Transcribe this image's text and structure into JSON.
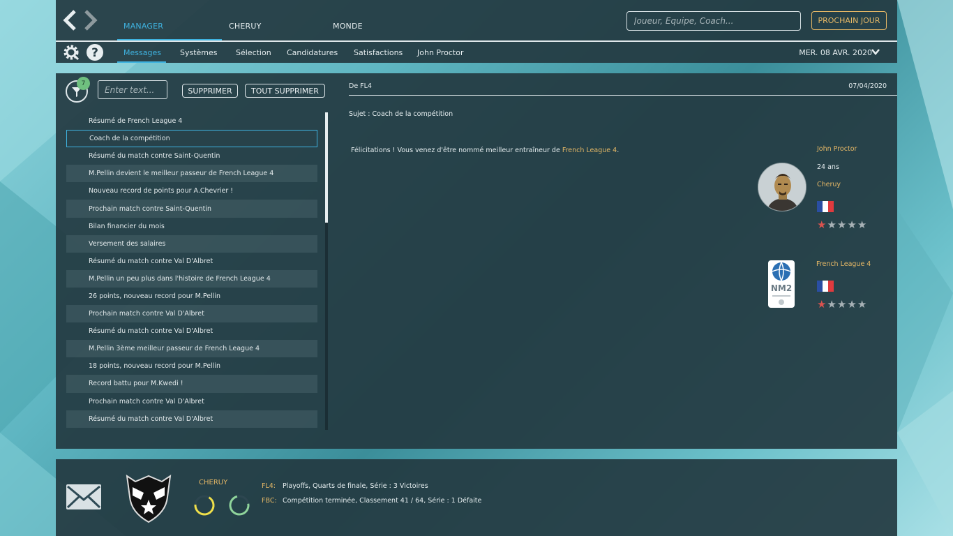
{
  "nav": {
    "back_icon": "chevron-left-icon",
    "forward_icon": "chevron-right-icon",
    "tabs": [
      {
        "label": "MANAGER"
      },
      {
        "label": "CHERUY"
      },
      {
        "label": "MONDE"
      }
    ],
    "search_placeholder": "Joueur, Equipe, Coach...",
    "next_day_label": "PROCHAIN JOUR",
    "subtabs": [
      {
        "label": "Messages"
      },
      {
        "label": "Systèmes"
      },
      {
        "label": "Sélection"
      },
      {
        "label": "Candidatures"
      },
      {
        "label": "Satisfactions"
      },
      {
        "label": "John Proctor"
      }
    ],
    "date": "MER. 08 AVR. 2020",
    "accent_color": "#3fb3e0"
  },
  "inbox": {
    "filter_count": "7",
    "filter_placeholder": "Enter text...",
    "delete_label": "SUPPRIMER",
    "delete_all_label": "TOUT SUPPRIMER",
    "messages": [
      {
        "subject": "Résumé de French League 4"
      },
      {
        "subject": "Coach de la compétition"
      },
      {
        "subject": "Résumé du match contre Saint-Quentin"
      },
      {
        "subject": "M.Pellin devient le meilleur passeur de French League 4"
      },
      {
        "subject": "Nouveau record de points pour A.Chevrier !"
      },
      {
        "subject": "Prochain match contre Saint-Quentin"
      },
      {
        "subject": "Bilan financier du mois"
      },
      {
        "subject": "Versement des salaires"
      },
      {
        "subject": "Résumé du match contre Val D'Albret"
      },
      {
        "subject": "M.Pellin un peu plus dans l'histoire de French League 4"
      },
      {
        "subject": "26 points, nouveau record pour M.Pellin"
      },
      {
        "subject": "Prochain match contre Val D'Albret"
      },
      {
        "subject": "Résumé du match contre Val D'Albret"
      },
      {
        "subject": "M.Pellin 3ème meilleur passeur de French League 4"
      },
      {
        "subject": "18 points, nouveau record pour M.Pellin"
      },
      {
        "subject": "Record battu pour M.Kwedi !"
      },
      {
        "subject": "Prochain match contre Val D'Albret"
      },
      {
        "subject": "Résumé du match contre Val D'Albret"
      }
    ],
    "selected_index": 1
  },
  "detail": {
    "from": "De FL4",
    "date": "07/04/2020",
    "subject": "Sujet : Coach de la compétition",
    "body_prefix": "Félicitations ! Vous venez d'être nommé meilleur entraîneur de ",
    "body_link": "French League 4",
    "body_suffix": ".",
    "person": {
      "name": "John Proctor",
      "age": "24 ans",
      "team": "Cheruy",
      "nationality_flag": "france-flag-icon",
      "rating": 1,
      "max_rating": 5
    },
    "league": {
      "name": "French League 4",
      "logo_text": "NM2",
      "nationality_flag": "france-flag-icon",
      "rating": 1,
      "max_rating": 5
    }
  },
  "footer": {
    "mail_icon": "mail-icon",
    "club": "CHERUY",
    "ring1_color": "#f0e04a",
    "ring2_color": "#8fd49b",
    "results": [
      {
        "label": "FL4:",
        "text": "Playoffs, Quarts de finale, Série : 3 Victoires"
      },
      {
        "label": "FBC:",
        "text": "Compétition terminée, Classement 41 / 64, Série : 1 Défaite"
      }
    ]
  }
}
